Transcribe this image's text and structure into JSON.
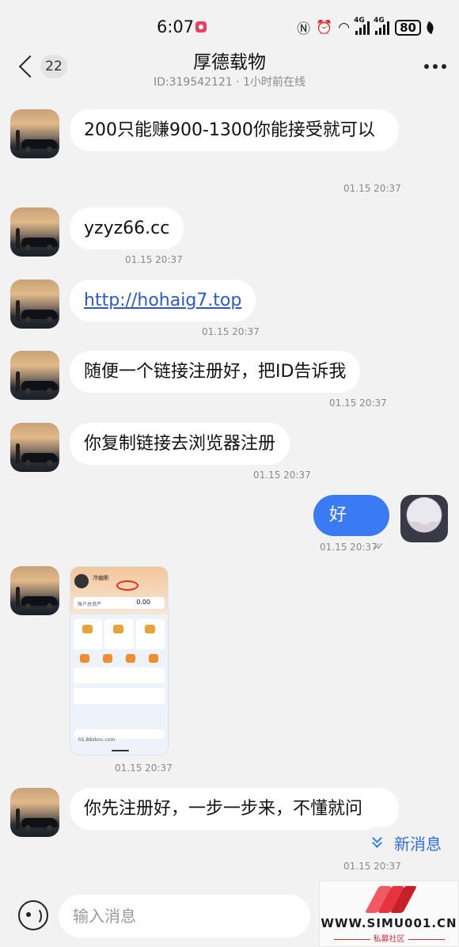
{
  "status_bar": {
    "time": "6:07",
    "battery": "80",
    "network_a": "4G",
    "network_b": "4G"
  },
  "header": {
    "unread_count": "22",
    "title": "厚德载物",
    "subtitle": "ID:319542121 · 1小时前在线"
  },
  "messages": [
    {
      "text": "200只能赚900-1300你能接受就可以",
      "time": "01.15 20:37"
    },
    {
      "text": "yzyz66.cc",
      "time": "01.15 20:37"
    },
    {
      "text": "http://hohaig7.top",
      "time": "01.15 20:37"
    },
    {
      "text": "随便一个链接注册好，把ID告诉我",
      "time": "01.15 20:37"
    },
    {
      "text": "你复制链接去浏览器注册",
      "time": "01.15 20:37"
    },
    {
      "text": "好",
      "time": "01.15 20:37",
      "sender": "self"
    },
    {
      "text": "",
      "time": "01.15 20:37",
      "type": "image"
    },
    {
      "text": "你先注册好，一步一步来，不懂就问",
      "time": "01.15 20:37"
    }
  ],
  "screenshot_preview": {
    "name": "冷幽影",
    "asset_label": "账户总资产",
    "asset_value": "0.00",
    "url": "h5.88xbnc.com"
  },
  "new_message_label": "新消息",
  "input": {
    "placeholder": "输入消息"
  },
  "watermark": {
    "text": "WWW.SIMU001.CN",
    "sub": "私募社区"
  }
}
